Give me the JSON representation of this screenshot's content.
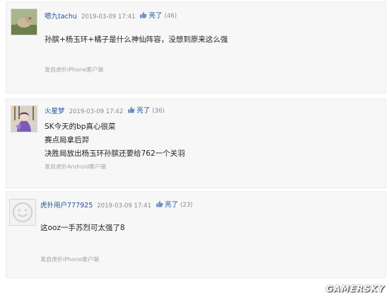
{
  "comments": [
    {
      "username": "嗯九tachu",
      "timestamp": "2019-03-09 17:41",
      "light_label": "亮了",
      "light_count": "(46)",
      "lines": [
        "孙膑+杨玉环+橘子是什么神仙阵容，没想到原来这么强"
      ],
      "source": "发自虎扑iPhone客户端",
      "avatar_icon": "bird-photo-avatar"
    },
    {
      "username": "火星梦",
      "timestamp": "2019-03-09 17:42",
      "light_label": "亮了",
      "light_count": "(36)",
      "lines": [
        "SK今天的bp真心很菜",
        "赛点局拿后羿",
        "决胜局放出杨玉环孙膑还要给762一个关羽"
      ],
      "source": "发自虎扑Android客户端",
      "avatar_icon": "anime-character-avatar"
    },
    {
      "username": "虎扑用户777925",
      "timestamp": "2019-03-09 17:41",
      "light_label": "亮了",
      "light_count": "(23)",
      "lines": [
        "这ooz一手苏烈可太强了8"
      ],
      "source": "发自虎扑iPhone客户端",
      "avatar_icon": "default-smiley-avatar"
    }
  ],
  "light_icon": "thumb-up-icon",
  "colors": {
    "username": "#1e4f99",
    "card_bg": "#f7f7f7"
  },
  "watermark": "GAMERSKY"
}
